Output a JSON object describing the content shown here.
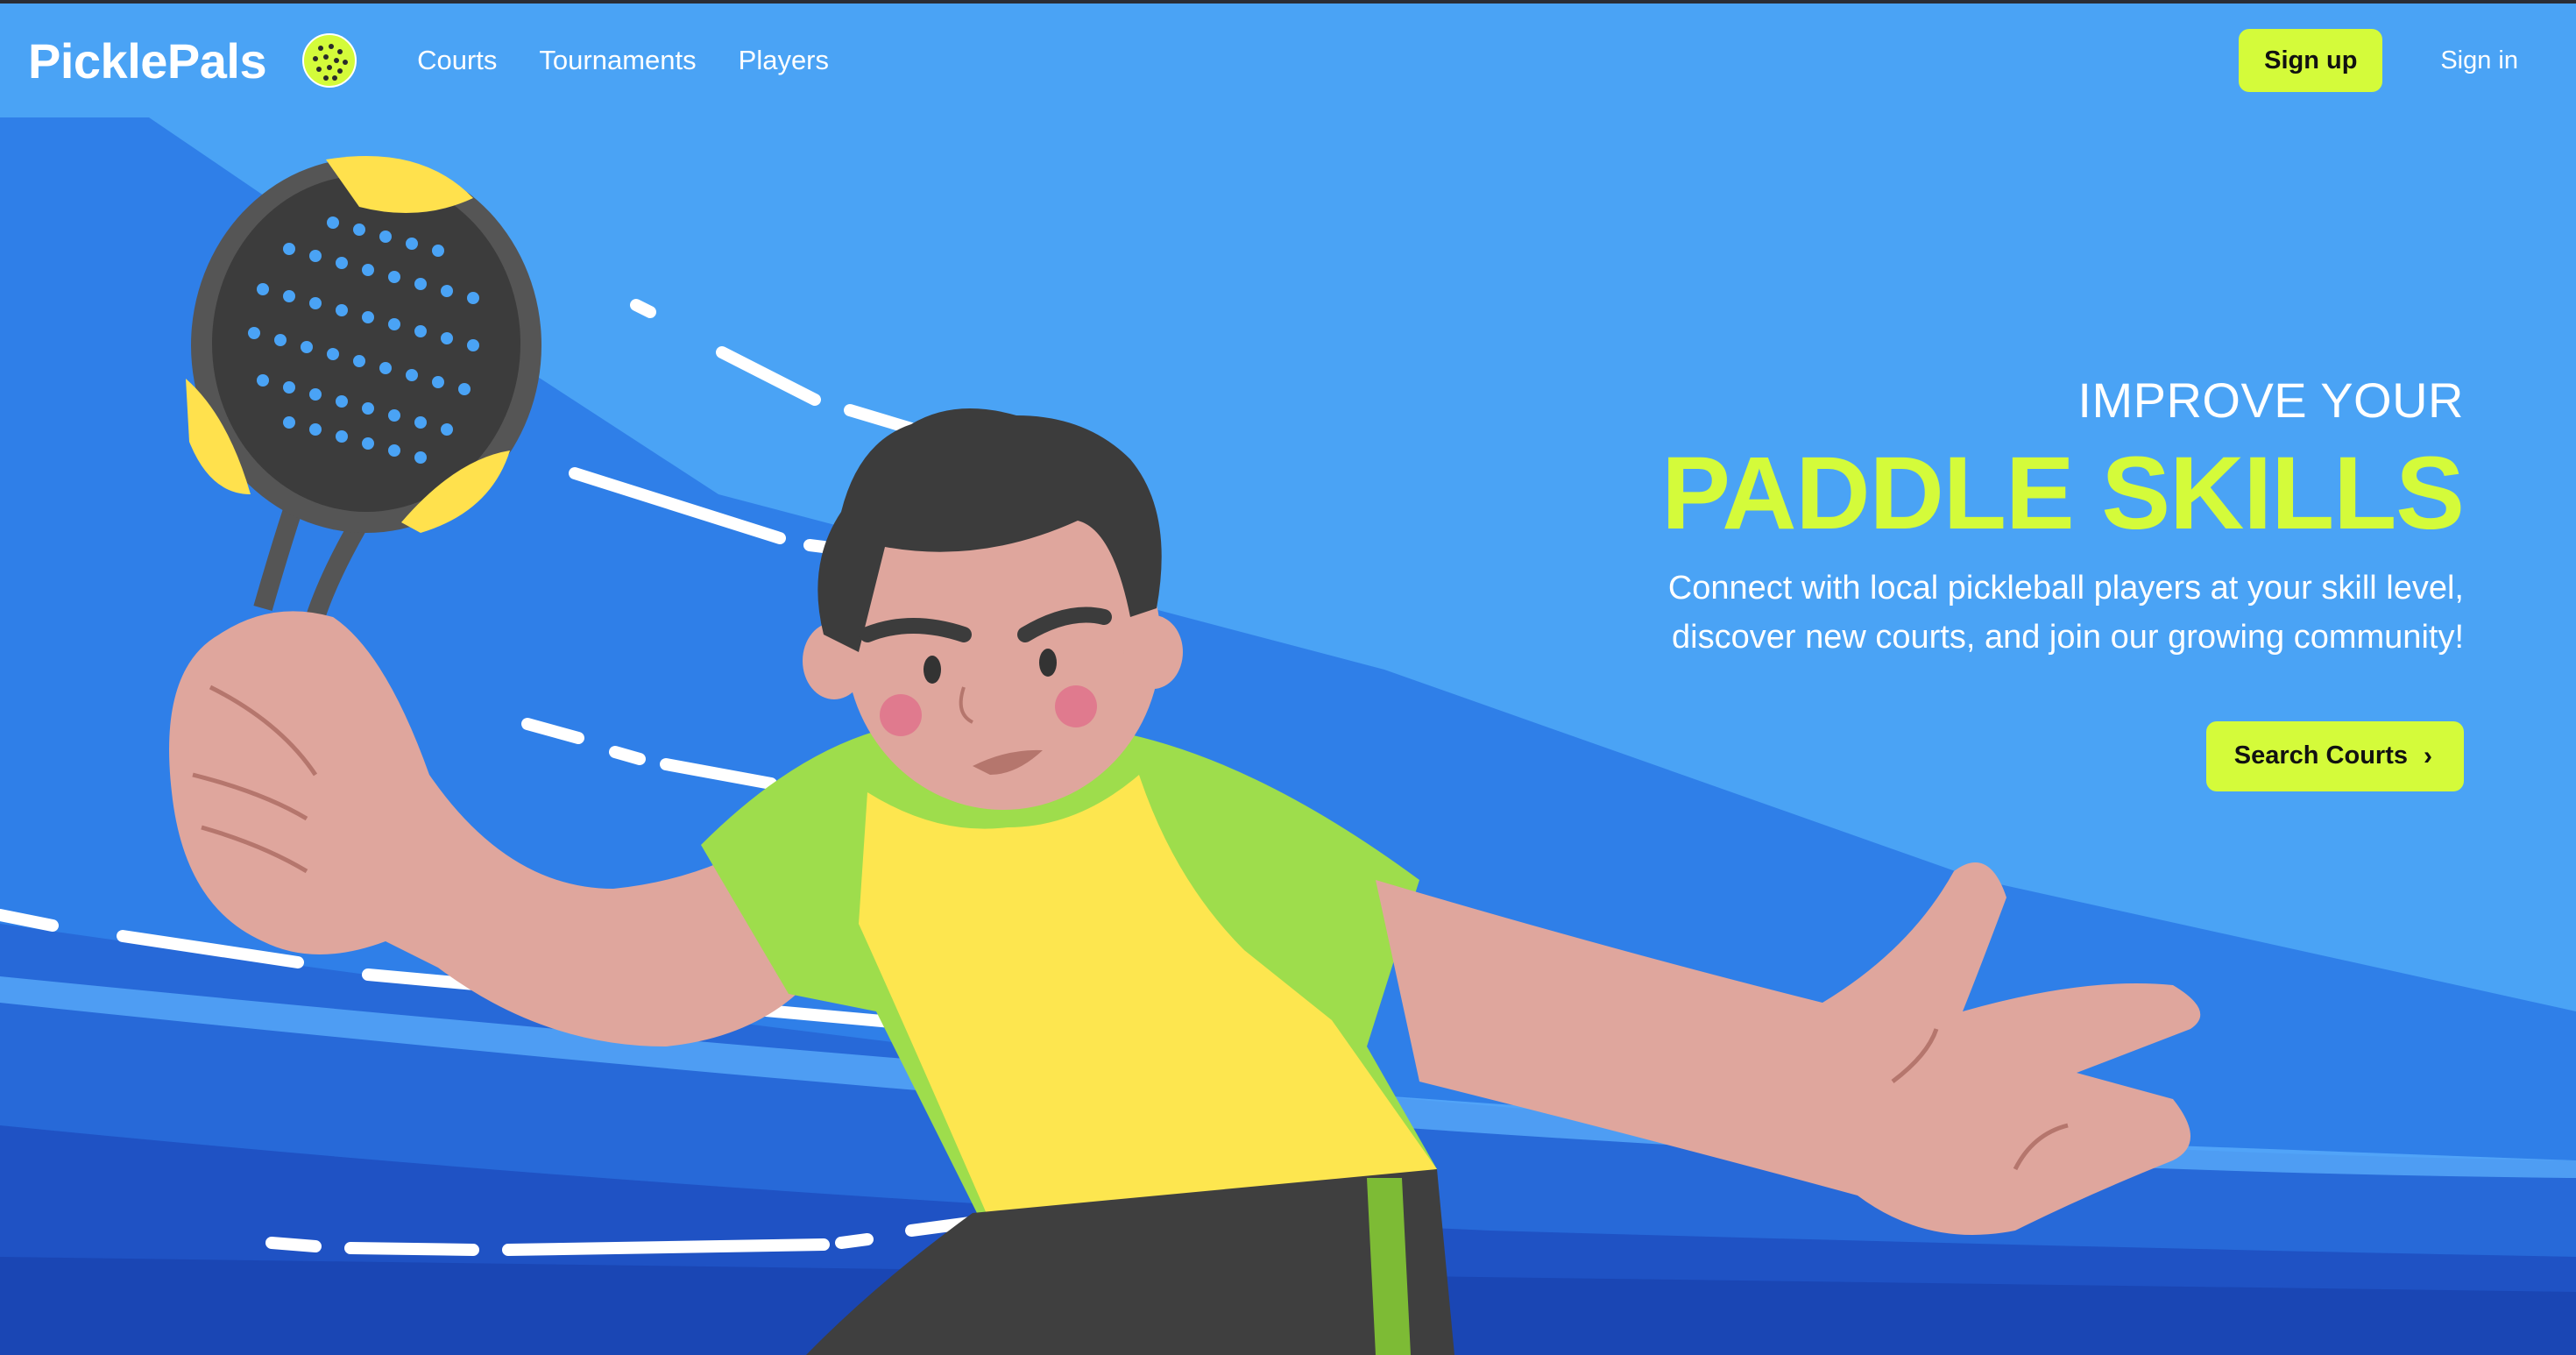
{
  "nav": {
    "logo": "PicklePals",
    "links": [
      "Courts",
      "Tournaments",
      "Players"
    ],
    "signup_label": "Sign up",
    "signin_label": "Sign in"
  },
  "hero": {
    "eyebrow": "IMPROVE YOUR",
    "headline": "PADDLE SKILLS",
    "subcopy_line1": "Connect with local pickleball players at your skill level,",
    "subcopy_line2": "discover new courts, and join our growing community!",
    "cta_label": "Search Courts"
  },
  "colors": {
    "background": "#4aa3f5",
    "accent": "#d4fb3a",
    "text": "#ffffff"
  },
  "icons": {
    "logo_ball": "pickleball-icon",
    "cta_chevron": "chevron-right-icon"
  }
}
